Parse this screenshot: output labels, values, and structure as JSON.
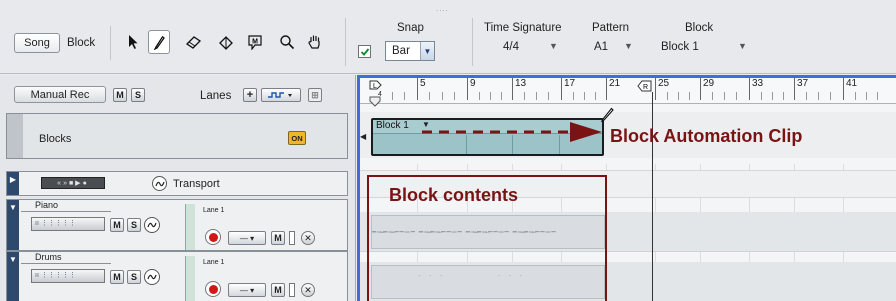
{
  "toolbar": {
    "song_label": "Song",
    "block_label": "Block",
    "tools": [
      "select-arrow-icon",
      "pencil-icon",
      "eraser-icon",
      "razor-icon",
      "mute-icon",
      "magnify-icon",
      "hand-icon"
    ],
    "snap": {
      "header": "Snap",
      "checked": true,
      "value": "Bar"
    },
    "time_signature": {
      "header": "Time Signature",
      "value": "4/4"
    },
    "pattern": {
      "header": "Pattern",
      "value": "A1"
    },
    "block": {
      "header": "Block",
      "value": "Block 1"
    }
  },
  "left_panel": {
    "manual_rec": "Manual Rec",
    "m": "M",
    "s": "S",
    "lanes_label": "Lanes",
    "lanes_plus": "+",
    "blocks_label": "Blocks",
    "blocks_on": "ON",
    "tracks": [
      {
        "name": "Transport",
        "transport_symbols": "«»■▶●"
      },
      {
        "name": "Piano",
        "lane": "Lane 1",
        "m": "M",
        "s": "S"
      },
      {
        "name": "Drums",
        "lane": "Lane 1",
        "m": "M",
        "s": "S"
      }
    ]
  },
  "ruler": {
    "bars": [
      "5",
      "9",
      "13",
      "17",
      "21",
      "25",
      "29",
      "33",
      "37",
      "41"
    ],
    "start_marker": "L",
    "start_sub": "4",
    "end_marker": "R"
  },
  "clip": {
    "name": "Block 1"
  },
  "annotations": {
    "automation": "Block Automation Clip",
    "contents": "Block contents"
  },
  "colors": {
    "annotation": "#7a1414",
    "clip_fill": "#9cc3c8",
    "selection": "#3e6fd6"
  }
}
